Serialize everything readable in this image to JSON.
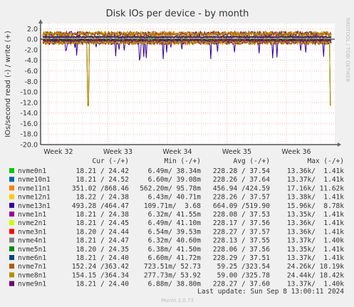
{
  "chart_data": {
    "type": "line",
    "title": "Disk IOs per device - by month",
    "ylabel": "IOs/second read (-) / write (+)",
    "side_label": "RRDTOOL / TOBI OETIKER",
    "ylim": [
      -20,
      3
    ],
    "y_ticks": [
      "2.0",
      "0.0",
      "-2.0",
      "-4.0",
      "-6.0",
      "-8.0",
      "-10.0",
      "-12.0",
      "-14.0",
      "-16.0",
      "-18.0",
      "-20.0"
    ],
    "y_tick_values": [
      2,
      0,
      -2,
      -4,
      -6,
      -8,
      -10,
      -12,
      -14,
      -16,
      -18,
      -20
    ],
    "x_ticks": [
      "Week 32",
      "Week 33",
      "Week 34",
      "Week 35",
      "Week 36"
    ],
    "grid": true,
    "legend": {
      "headers": [
        "Cur (-/+)",
        "Min (-/+)",
        "Avg (-/+)",
        "Max (-/+)"
      ],
      "rows": [
        {
          "name": "nvme0n1",
          "color": "#00cc00",
          "cur": "18.21 / 24.42",
          "min": "6.49m/ 38.34m",
          "avg": "228.28 / 37.54",
          "max": "13.36k/  1.41k"
        },
        {
          "name": "nvme10n1",
          "color": "#0066b3",
          "cur": "18.21 / 24.52",
          "min": "6.60m/ 39.08m",
          "avg": "228.26 / 37.64",
          "max": "13.37k/  1.41k"
        },
        {
          "name": "nvme11n1",
          "color": "#ff8000",
          "cur": "351.02 /868.46",
          "min": "562.20m/ 95.78m",
          "avg": "456.94 /424.59",
          "max": "17.16k/ 11.62k"
        },
        {
          "name": "nvme12n1",
          "color": "#ffcc00",
          "cur": "18.22 / 24.38",
          "min": "6.43m/ 40.71m",
          "avg": "228.26 / 37.57",
          "max": "13.38k/  1.41k"
        },
        {
          "name": "nvme13n1",
          "color": "#330099",
          "cur": "493.28 /464.47",
          "min": "109.71m/  3.68",
          "avg": "664.09 /519.90",
          "max": "15.96k/  8.78k"
        },
        {
          "name": "nvme1n1",
          "color": "#990099",
          "cur": "18.21 / 24.38",
          "min": "6.32m/ 41.55m",
          "avg": "228.08 / 37.53",
          "max": "13.35k/  1.41k"
        },
        {
          "name": "nvme2n1",
          "color": "#ccff00",
          "cur": "18.21 / 24.45",
          "min": "6.49m/ 41.10m",
          "avg": "228.17 / 37.56",
          "max": "13.36k/  1.41k"
        },
        {
          "name": "nvme3n1",
          "color": "#ff0000",
          "cur": "18.20 / 24.44",
          "min": "6.54m/ 39.53m",
          "avg": "228.27 / 37.57",
          "max": "13.36k/  1.41k"
        },
        {
          "name": "nvme4n1",
          "color": "#808080",
          "cur": "18.21 / 24.47",
          "min": "6.32m/ 40.60m",
          "avg": "228.13 / 37.55",
          "max": "13.37k/  1.40k"
        },
        {
          "name": "nvme5n1",
          "color": "#008f00",
          "cur": "18.20 / 24.35",
          "min": "6.38m/ 41.50m",
          "avg": "228.06 / 37.56",
          "max": "13.35k/  1.41k"
        },
        {
          "name": "nvme6n1",
          "color": "#00487d",
          "cur": "18.21 / 24.40",
          "min": "6.60m/ 41.72m",
          "avg": "228.29 / 37.51",
          "max": "13.37k/  1.41k"
        },
        {
          "name": "nvme7n1",
          "color": "#b35a00",
          "cur": "152.24 /363.42",
          "min": "723.51m/ 52.73",
          "avg": "59.25 /323.54",
          "max": "24.26k/ 18.19k"
        },
        {
          "name": "nvme8n1",
          "color": "#b38f00",
          "cur": "154.15 /364.34",
          "min": "277.73m/ 53.92",
          "avg": "59.00 /325.78",
          "max": "24.44k/ 18.42k"
        },
        {
          "name": "nvme9n1",
          "color": "#6b006b",
          "cur": "18.21 / 24.40",
          "min": "6.88m/ 38.80m",
          "avg": "228.27 / 37.60",
          "max": "13.37k/  1.40k"
        }
      ]
    },
    "last_update": "Last update: Sun Sep  8 13:00:11 2024",
    "footer": "Munin 2.0.73"
  }
}
